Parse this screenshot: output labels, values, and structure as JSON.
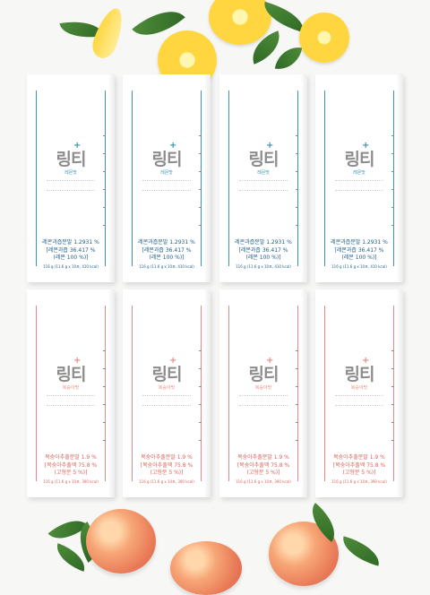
{
  "lemon_pack": {
    "brand": "링티",
    "flavor": "레몬맛",
    "ingredient_lines": [
      "레몬과즙분말 1.2931 %",
      "[레몬과즙 36.417 %",
      "(레몬 100 %)]"
    ],
    "footer": "116 g (11.6 g x 10포, 410 kcal)"
  },
  "peach_pack": {
    "brand": "링티",
    "flavor": "복숭아맛",
    "ingredient_lines": [
      "복숭아추출분말 1.9 %",
      "[복숭아추출액 75.8 %",
      "(고형분 5 %)]"
    ],
    "footer": "116 g (11.6 g x 10포, 390 kcal)"
  },
  "colors": {
    "lemon_accent": "#3a94b8",
    "peach_accent": "#e78a80"
  }
}
